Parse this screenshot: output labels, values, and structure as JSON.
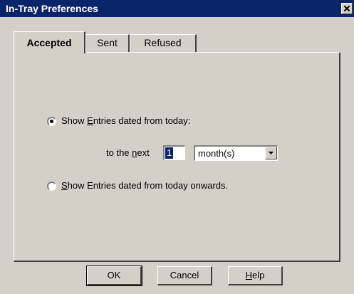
{
  "window": {
    "title": "In-Tray Preferences"
  },
  "tabs": [
    {
      "label": "Accepted",
      "active": true
    },
    {
      "label": "Sent",
      "active": false
    },
    {
      "label": "Refused",
      "active": false
    }
  ],
  "options": {
    "option1": {
      "pre": "Show ",
      "mnemonic": "E",
      "post": "ntries dated from today:",
      "selected": true
    },
    "next": {
      "pre": "to the ",
      "mnemonic": "n",
      "post": "ext",
      "value": "1",
      "unit": "month(s)"
    },
    "option2": {
      "pre": "",
      "mnemonic": "S",
      "post": "how Entries dated from today onwards.",
      "selected": false
    }
  },
  "buttons": {
    "ok": "OK",
    "cancel": "Cancel",
    "help": {
      "mnemonic": "H",
      "rest": "elp"
    }
  },
  "icons": {
    "close": "close-icon",
    "dropdown": "chevron-down-icon"
  },
  "colors": {
    "titlebar": "#0a246a",
    "face": "#d4d0c8"
  }
}
